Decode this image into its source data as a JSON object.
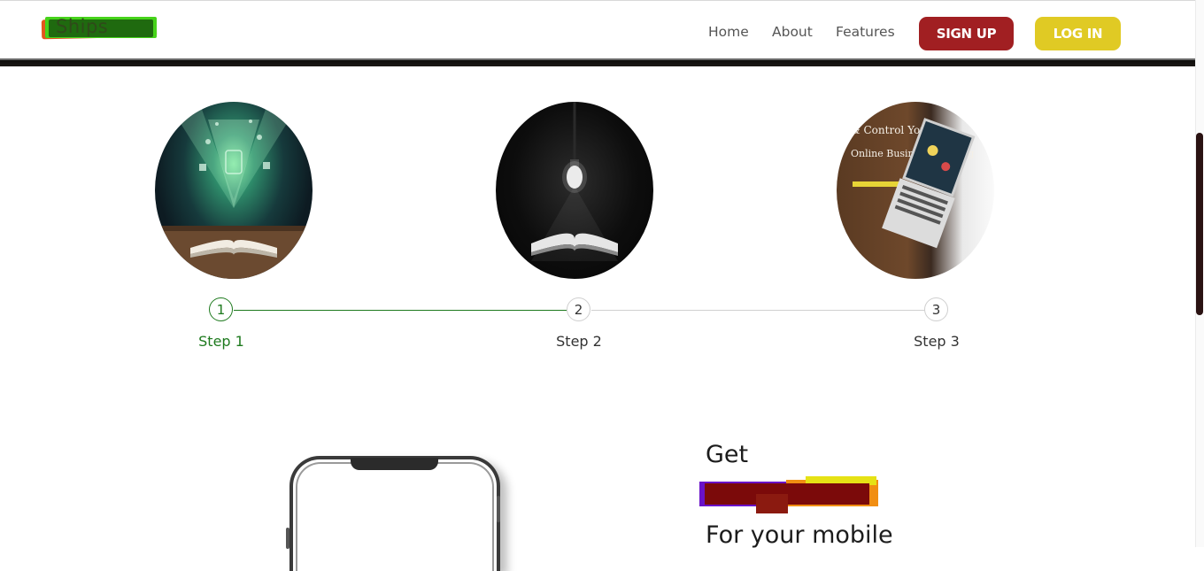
{
  "header": {
    "logo_text": "Ships",
    "nav": [
      "Home",
      "About",
      "Features"
    ],
    "signup_label": "SIGN UP",
    "login_label": "LOG IN"
  },
  "steps": [
    {
      "number": "1",
      "label": "Step 1",
      "active": true,
      "image": "book-lights-image"
    },
    {
      "number": "2",
      "label": "Step 2",
      "active": false,
      "image": "lightbulb-book-image"
    },
    {
      "number": "3",
      "label": "Step 3",
      "active": false,
      "image": "laptop-desk-image",
      "image_text": [
        "& Control Your",
        "Online Business Meeting"
      ]
    }
  ],
  "promo": {
    "heading_1": "Get",
    "heading_3": "For your mobile"
  },
  "colors": {
    "signup": "#a11f22",
    "login": "#e0ca24",
    "active_step": "#1e7a1e"
  }
}
